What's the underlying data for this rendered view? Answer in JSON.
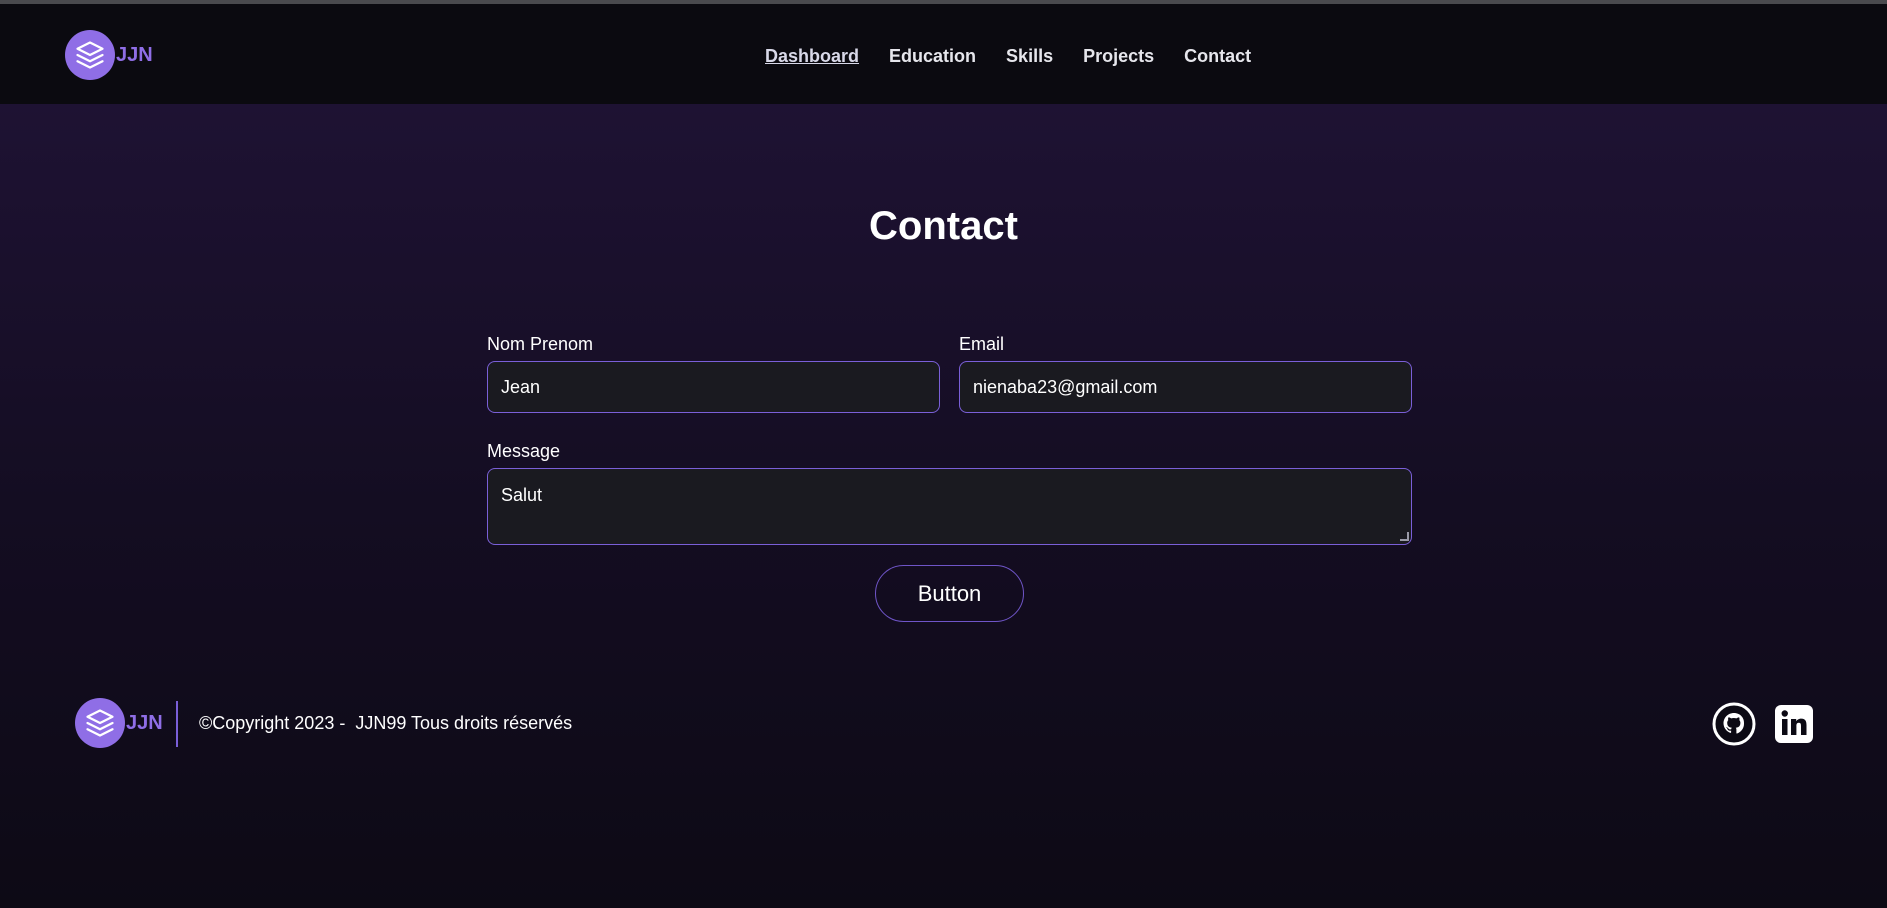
{
  "header": {
    "logo_text": "JJN",
    "nav": [
      {
        "label": "Dashboard",
        "active": true
      },
      {
        "label": "Education",
        "active": false
      },
      {
        "label": "Skills",
        "active": false
      },
      {
        "label": "Projects",
        "active": false
      },
      {
        "label": "Contact",
        "active": false
      }
    ]
  },
  "main": {
    "title": "Contact",
    "form": {
      "name_label": "Nom Prenom",
      "name_value": "Jean",
      "email_label": "Email",
      "email_value": "nienaba23@gmail.com",
      "message_label": "Message",
      "message_value": "Salut",
      "submit_label": "Button"
    }
  },
  "footer": {
    "logo_text": "JJN",
    "copyright": "©Copyright 2023 -  JJN99 Tous droits réservés",
    "social": [
      {
        "icon": "github-icon"
      },
      {
        "icon": "linkedin-icon"
      }
    ]
  },
  "colors": {
    "accent": "#8f6ee6",
    "background_top": "#1e1233",
    "background_bottom": "#0d0a15",
    "header": "#0b0a10",
    "field_bg": "#1a1a20",
    "field_border": "#7a5fd8"
  }
}
